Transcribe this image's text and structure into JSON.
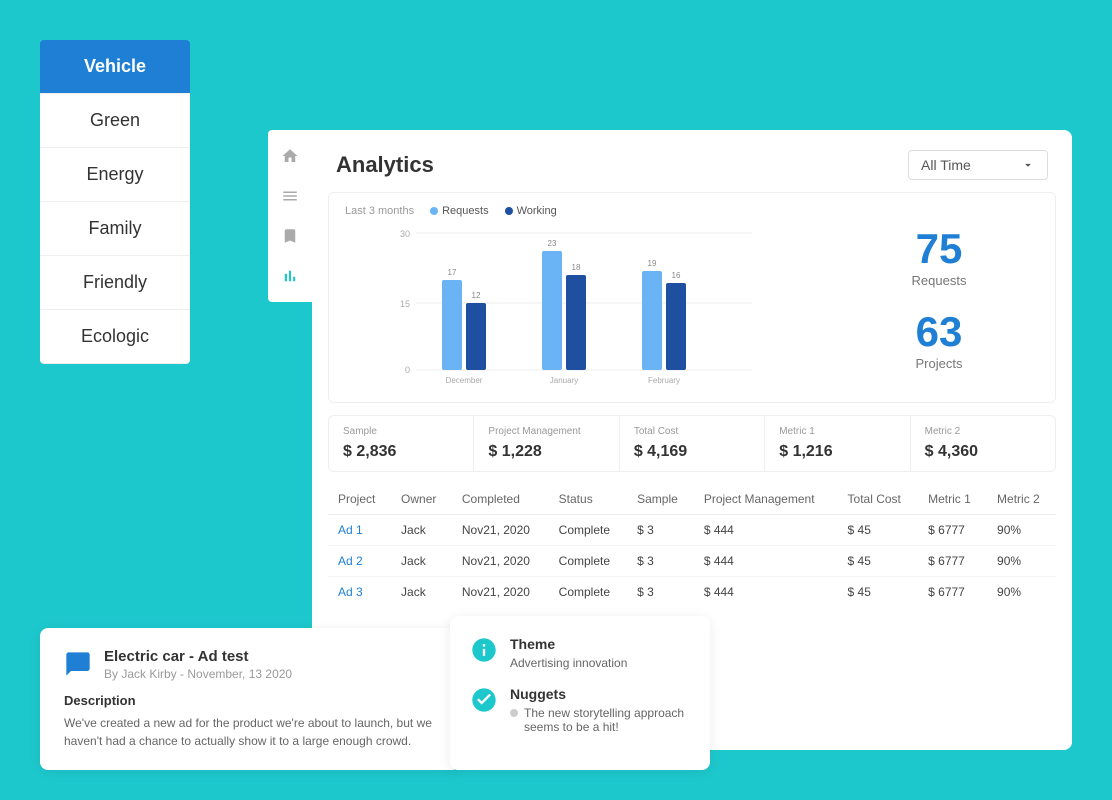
{
  "sidebar": {
    "items": [
      {
        "id": "vehicle",
        "label": "Vehicle",
        "active": true
      },
      {
        "id": "green",
        "label": "Green"
      },
      {
        "id": "energy",
        "label": "Energy"
      },
      {
        "id": "family",
        "label": "Family"
      },
      {
        "id": "friendly",
        "label": "Friendly"
      },
      {
        "id": "ecologic",
        "label": "Ecologic"
      }
    ]
  },
  "icon_nav": [
    {
      "id": "home",
      "icon": "⌂",
      "active": false
    },
    {
      "id": "list",
      "icon": "≡",
      "active": false
    },
    {
      "id": "bookmark",
      "icon": "⊟",
      "active": false
    },
    {
      "id": "chart",
      "icon": "▐",
      "active": true
    }
  ],
  "header": {
    "title": "Analytics",
    "time_filter": "All Time"
  },
  "chart": {
    "period": "Last 3 months",
    "legend": [
      {
        "label": "Requests",
        "color": "#6ab4f5"
      },
      {
        "label": "Working",
        "color": "#1e4fa0"
      }
    ],
    "months": [
      "December",
      "January",
      "February"
    ],
    "requests": [
      17,
      23,
      19
    ],
    "working": [
      12,
      18,
      16
    ],
    "y_max": 30,
    "y_labels": [
      30,
      15,
      0
    ]
  },
  "stats": {
    "requests": {
      "value": "75",
      "label": "Requests"
    },
    "projects": {
      "value": "63",
      "label": "Projects"
    }
  },
  "metrics": [
    {
      "id": "sample",
      "name": "Sample",
      "value": "$ 2,836"
    },
    {
      "id": "project_management",
      "name": "Project Management",
      "value": "$ 1,228"
    },
    {
      "id": "total_cost",
      "name": "Total Cost",
      "value": "$ 4,169"
    },
    {
      "id": "metric1",
      "name": "Metric 1",
      "value": "$ 1,216"
    },
    {
      "id": "metric2",
      "name": "Metric 2",
      "value": "$ 4,360"
    }
  ],
  "table": {
    "columns": [
      "Project",
      "Owner",
      "Completed",
      "Status",
      "Sample",
      "Project Management",
      "Total Cost",
      "Metric 1",
      "Metric 2"
    ],
    "rows": [
      {
        "project": "Ad 1",
        "owner": "Jack",
        "completed": "Nov21, 2020",
        "status": "Complete",
        "sample": "$ 3",
        "pm": "$ 444",
        "total": "$ 45",
        "m1": "$ 6777",
        "m2": "90%"
      },
      {
        "project": "Ad 2",
        "owner": "Jack",
        "completed": "Nov21, 2020",
        "status": "Complete",
        "sample": "$ 3",
        "pm": "$ 444",
        "total": "$ 45",
        "m1": "$ 6777",
        "m2": "90%"
      },
      {
        "project": "Ad 3",
        "owner": "Jack",
        "completed": "Nov21, 2020",
        "status": "Complete",
        "sample": "$ 3",
        "pm": "$ 444",
        "total": "$ 45",
        "m1": "$ 6777",
        "m2": "90%"
      }
    ]
  },
  "bottom_card": {
    "icon": "chat",
    "title": "Electric car - Ad test",
    "subtitle": "By Jack Kirby - November, 13 2020",
    "description_label": "Description",
    "description": "We've created a new ad for the product we're about to launch, but we haven't had a chance to actually show it to a large enough crowd."
  },
  "theme_block": {
    "label": "Theme",
    "text": "Advertising innovation"
  },
  "nuggets_block": {
    "label": "Nuggets",
    "items": [
      "The new storytelling approach seems to be a hit!"
    ]
  }
}
